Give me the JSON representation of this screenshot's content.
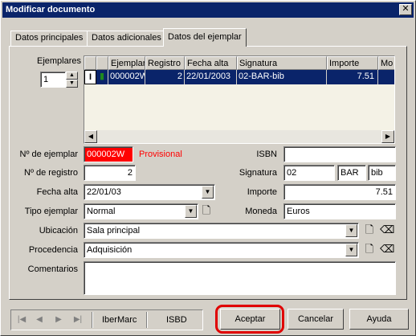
{
  "window": {
    "title": "Modificar documento",
    "close": "✕"
  },
  "tabs": [
    "Datos principales",
    "Datos adicionales",
    "Datos del ejemplar"
  ],
  "ejemplares": {
    "label": "Ejemplares",
    "count": "1"
  },
  "grid": {
    "columns": [
      "",
      "",
      "Ejemplar",
      "Registro",
      "Fecha alta",
      "Signatura",
      "Importe",
      "Mo"
    ],
    "row": {
      "marker": "I",
      "flag": "▮",
      "ejemplar": "000002W",
      "registro": "2",
      "fecha": "22/01/2003",
      "signatura": "02-BAR-bib",
      "importe": "7.51",
      "mo": ""
    }
  },
  "form": {
    "num_ejemplar": {
      "label": "Nº de ejemplar",
      "value": "000002W",
      "status": "Provisional"
    },
    "num_registro": {
      "label": "Nº de registro",
      "value": "2"
    },
    "fecha_alta": {
      "label": "Fecha alta",
      "value": "22/01/03"
    },
    "tipo_ejemplar": {
      "label": "Tipo ejemplar",
      "value": "Normal"
    },
    "isbn": {
      "label": "ISBN",
      "value": ""
    },
    "signatura": {
      "label": "Signatura",
      "part1": "02",
      "part2": "BAR",
      "part3": "bib"
    },
    "importe": {
      "label": "Importe",
      "value": "7.51"
    },
    "moneda": {
      "label": "Moneda",
      "value": "Euros"
    },
    "ubicacion": {
      "label": "Ubicación",
      "value": "Sala principal"
    },
    "procedencia": {
      "label": "Procedencia",
      "value": "Adquisición"
    },
    "comentarios": {
      "label": "Comentarios",
      "value": ""
    }
  },
  "navbar": {
    "ibermarc": "IberMarc",
    "isbd": "ISBD"
  },
  "buttons": {
    "aceptar": "Aceptar",
    "cancelar": "Cancelar",
    "ayuda": "Ayuda"
  },
  "colors": {
    "titlebar": "#0a246a",
    "selection": "#0a246a",
    "provisional": "#ff0000",
    "highlight": "#e00000"
  }
}
